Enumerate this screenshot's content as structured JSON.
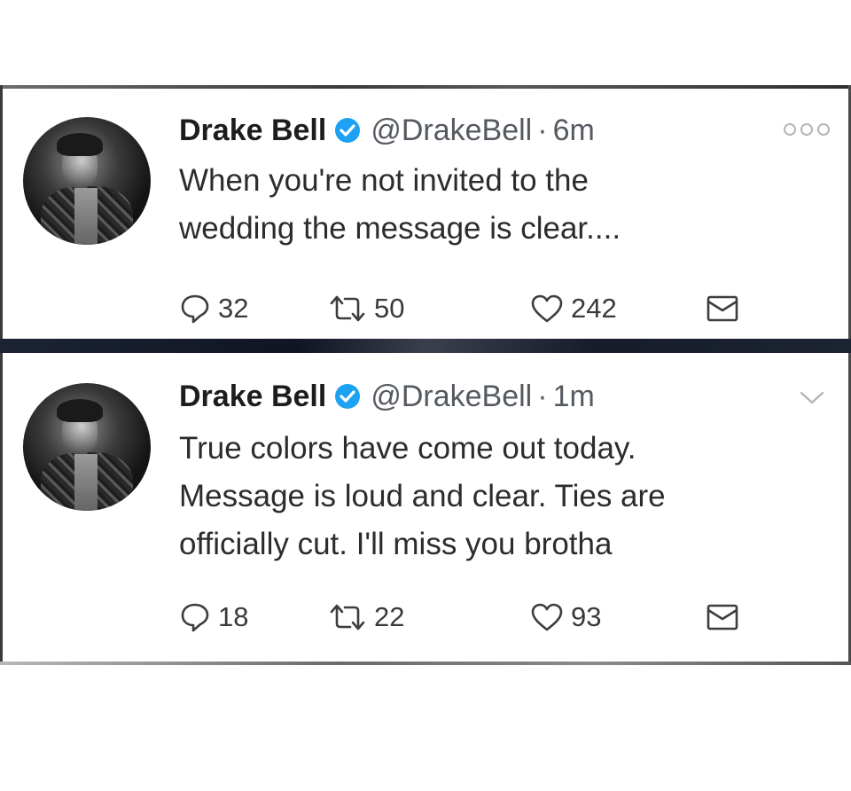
{
  "tweets": [
    {
      "name": "Drake Bell",
      "handle": "@DrakeBell",
      "separator": "·",
      "time": "6m",
      "lines": [
        "When you're not invited to the",
        "wedding the message is clear...."
      ],
      "replies": "32",
      "retweets": "50",
      "likes": "242",
      "menu_icon": "more-options-icon"
    },
    {
      "name": "Drake Bell",
      "handle": "@DrakeBell",
      "separator": "·",
      "time": "1m",
      "lines": [
        "True colors have come out today.",
        "Message is loud and clear. Ties are",
        "officially cut. I'll miss you brotha"
      ],
      "replies": "18",
      "retweets": "22",
      "likes": "93",
      "menu_icon": "chevron-down-icon"
    }
  ],
  "colors": {
    "verified": "#1da1f2",
    "text": "#2c2c2c",
    "secondary": "#555a60",
    "divider": "#0f1522"
  }
}
